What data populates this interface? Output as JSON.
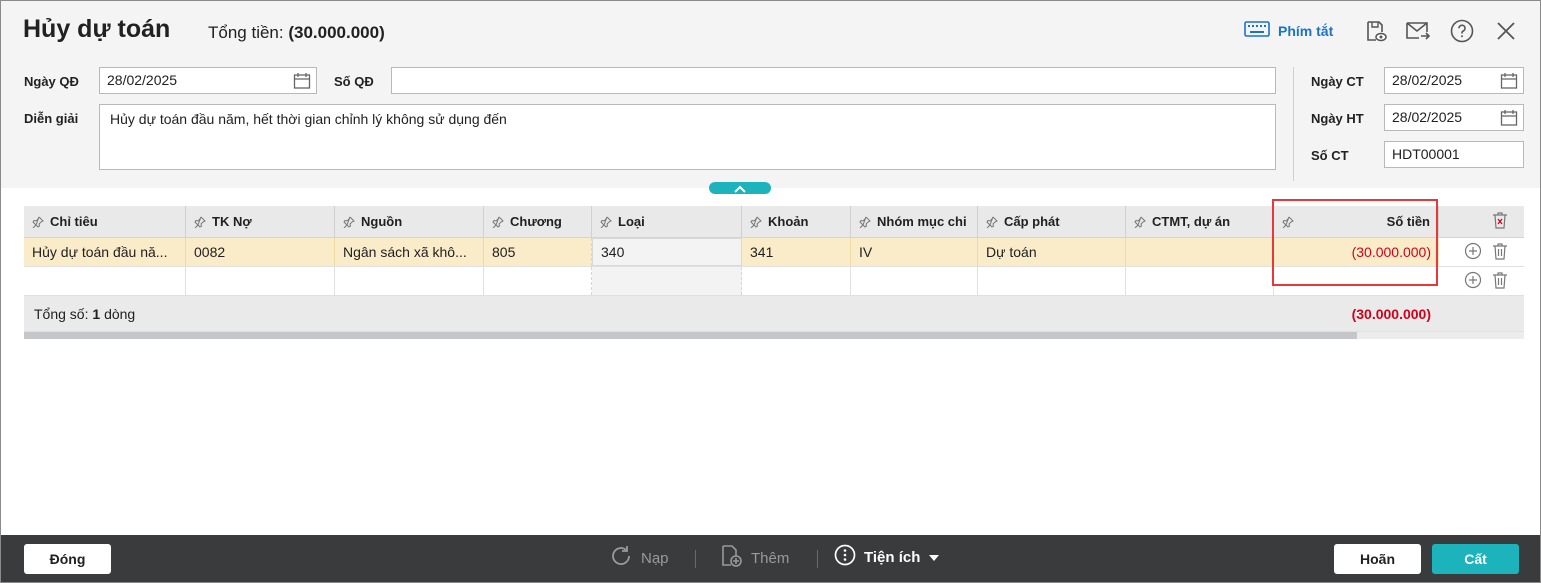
{
  "header": {
    "title": "Hủy dự toán",
    "total_label": "Tổng tiền:",
    "total_value": "(30.000.000)",
    "shortcut_label": "Phím tắt"
  },
  "form": {
    "ngay_qd": {
      "label": "Ngày QĐ",
      "value": "28/02/2025"
    },
    "so_qd": {
      "label": "Số QĐ",
      "value": ""
    },
    "dien_giai": {
      "label": "Diễn giải",
      "value": "Hủy dự toán đầu năm, hết thời gian chỉnh lý không sử dụng đến"
    },
    "ngay_ct": {
      "label": "Ngày CT",
      "value": "28/02/2025"
    },
    "ngay_ht": {
      "label": "Ngày HT",
      "value": "28/02/2025"
    },
    "so_ct": {
      "label": "Số CT",
      "value": "HDT00001"
    }
  },
  "grid": {
    "columns": [
      "Chỉ tiêu",
      "TK Nợ",
      "Nguồn",
      "Chương",
      "Loại",
      "Khoản",
      "Nhóm mục chi",
      "Cấp phát",
      "CTMT, dự án",
      "Số tiền"
    ],
    "rows": [
      [
        "Hủy dự toán đầu nă...",
        "0082",
        "Ngân sách xã khô...",
        "805",
        "340",
        "341",
        "IV",
        "Dự toán",
        "",
        "(30.000.000)"
      ]
    ],
    "footer_label": "Tổng số:",
    "footer_count": "1",
    "footer_unit": "dòng",
    "footer_total": "(30.000.000)"
  },
  "bottom": {
    "close": "Đóng",
    "reload": "Nạp",
    "add": "Thêm",
    "utilities": "Tiện ích",
    "cancel": "Hoãn",
    "save": "Cất"
  },
  "colors": {
    "accent": "#1cb3bd",
    "negative": "#d0021b",
    "link": "#1a73c6",
    "selected_row": "#fbecc9"
  }
}
